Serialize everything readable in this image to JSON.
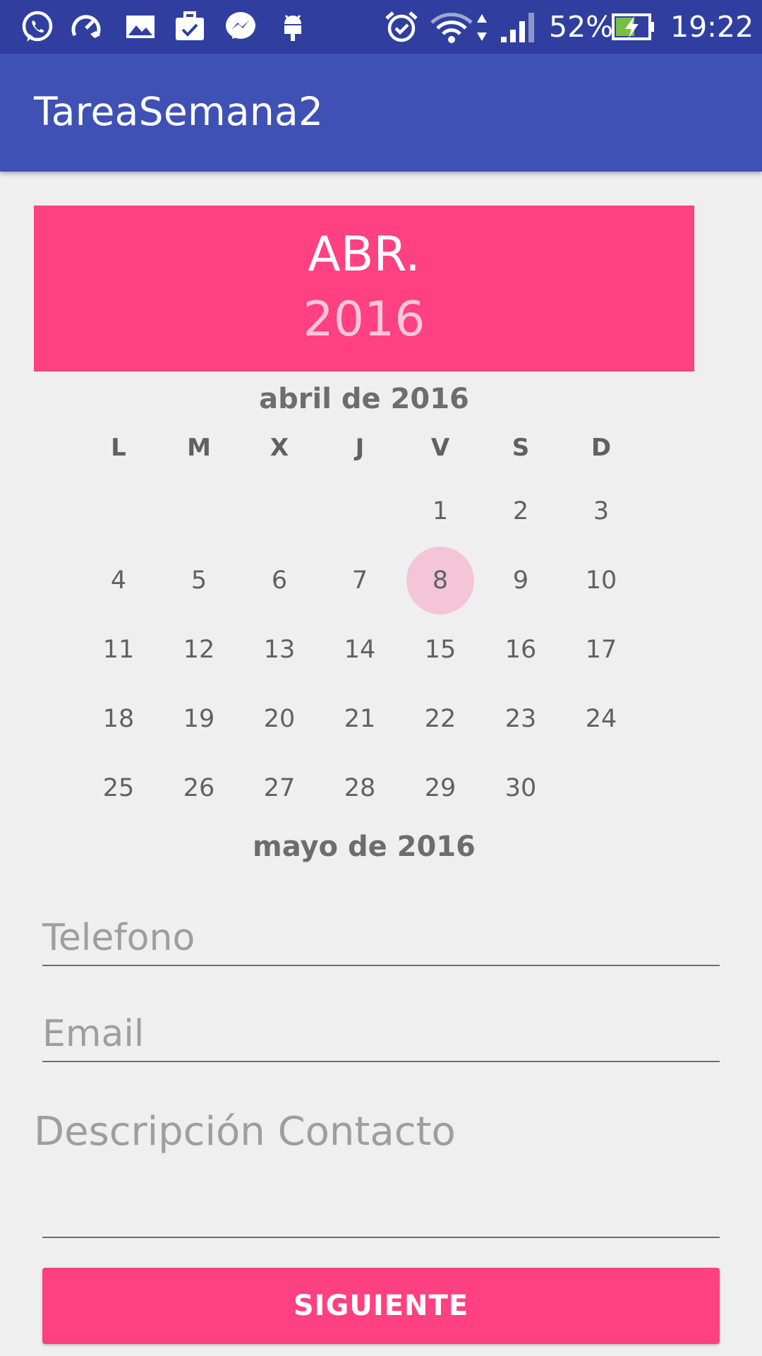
{
  "status_bar": {
    "icons": [
      "whatsapp-icon",
      "speed-icon",
      "gallery-icon",
      "briefcase-icon",
      "messenger-icon",
      "android-debug-icon",
      "alarm-icon",
      "wifi-icon",
      "data-arrows-icon",
      "signal-icon",
      "battery-charging-icon"
    ],
    "battery": "52%",
    "time": "19:22"
  },
  "app_bar": {
    "title": "TareaSemana2"
  },
  "calendar": {
    "header_month": "ABR.",
    "header_year": "2016",
    "month_title": "abril de 2016",
    "next_month_title": "mayo de 2016",
    "weekdays": [
      "L",
      "M",
      "X",
      "J",
      "V",
      "S",
      "D"
    ],
    "days": [
      [
        "",
        "",
        "",
        "",
        "1",
        "2",
        "3"
      ],
      [
        "4",
        "5",
        "6",
        "7",
        "8",
        "9",
        "10"
      ],
      [
        "11",
        "12",
        "13",
        "14",
        "15",
        "16",
        "17"
      ],
      [
        "18",
        "19",
        "20",
        "21",
        "22",
        "23",
        "24"
      ],
      [
        "25",
        "26",
        "27",
        "28",
        "29",
        "30",
        ""
      ]
    ],
    "selected_day": "8"
  },
  "form": {
    "phone_placeholder": "Telefono",
    "email_placeholder": "Email",
    "description_placeholder": "Descripción Contacto",
    "next_button": "SIGUIENTE"
  },
  "colors": {
    "primary": "#3f51b5",
    "primary_dark": "#303f9f",
    "accent": "#ff4081",
    "background": "#efefef"
  }
}
